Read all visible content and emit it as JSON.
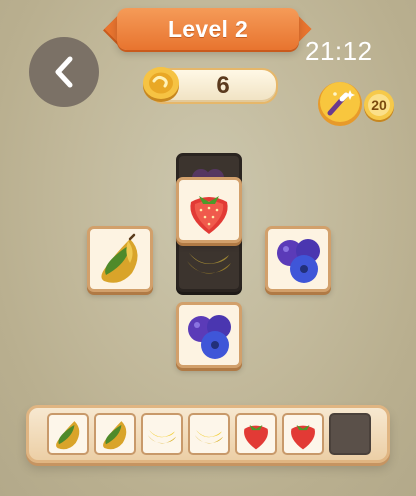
{
  "header": {
    "level_label": "Level 2",
    "clock": "21:12",
    "coins": "6",
    "magic_cost": "20"
  },
  "board": {
    "tiles": [
      {
        "fruit": "grape",
        "state": "covered"
      },
      {
        "fruit": "banana",
        "state": "covered"
      },
      {
        "fruit": "strawberry",
        "state": "open"
      },
      {
        "fruit": "mango",
        "state": "open"
      },
      {
        "fruit": "blueberry",
        "state": "open"
      },
      {
        "fruit": "blueberry",
        "state": "open"
      }
    ]
  },
  "tray": {
    "slots": [
      "mango",
      "mango",
      "banana",
      "banana",
      "strawberry",
      "strawberry",
      "empty"
    ],
    "capacity": 7
  },
  "icons": [
    "back-chevron-icon",
    "coin-icon",
    "magic-wand-icon",
    "coin-icon"
  ],
  "colors": {
    "banner": "#e8742f",
    "tile_border": "#d2a06b",
    "tray": "#eccfa6"
  }
}
